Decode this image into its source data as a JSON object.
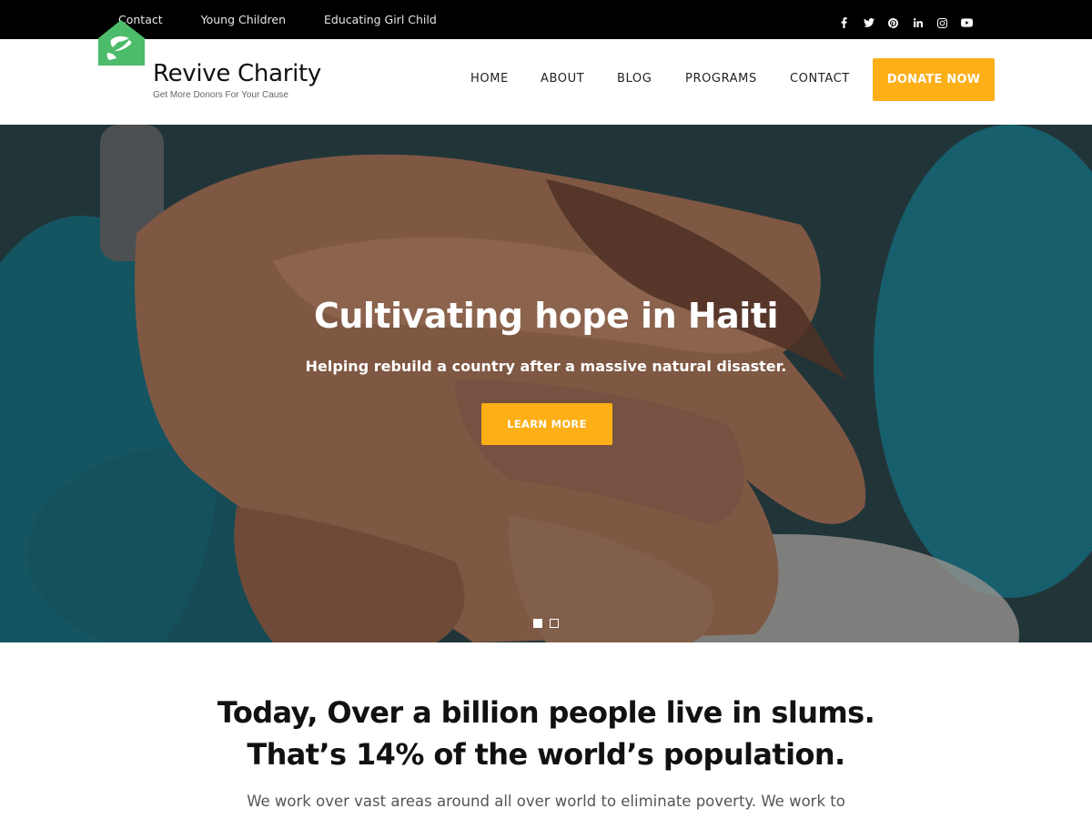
{
  "topbar": {
    "links": [
      "Contact",
      "Young Children",
      "Educating Girl Child"
    ],
    "social_icons": [
      "facebook-icon",
      "twitter-icon",
      "pinterest-icon",
      "linkedin-icon",
      "instagram-icon",
      "youtube-icon"
    ]
  },
  "brand": {
    "title": "Revive Charity",
    "tagline": "Get More Donors For Your Cause"
  },
  "nav": {
    "items": [
      "HOME",
      "ABOUT",
      "BLOG",
      "PROGRAMS",
      "CONTACT"
    ],
    "donate_label": "DONATE NOW"
  },
  "hero": {
    "title": "Cultivating hope in Haiti",
    "subtitle": "Helping rebuild a country after a massive natural disaster.",
    "button_label": "LEARN MORE",
    "slides_count": 2,
    "active_slide": 1
  },
  "intro": {
    "heading_line1": "Today, Over a billion people live in slums.",
    "heading_line2": "That’s 14% of the world’s population.",
    "paragraph": "We work over vast areas around all over world to eliminate poverty. We work to"
  },
  "colors": {
    "accent": "#fcaf17",
    "logo_green": "#4cbb6a",
    "topbar_bg": "#000000"
  }
}
